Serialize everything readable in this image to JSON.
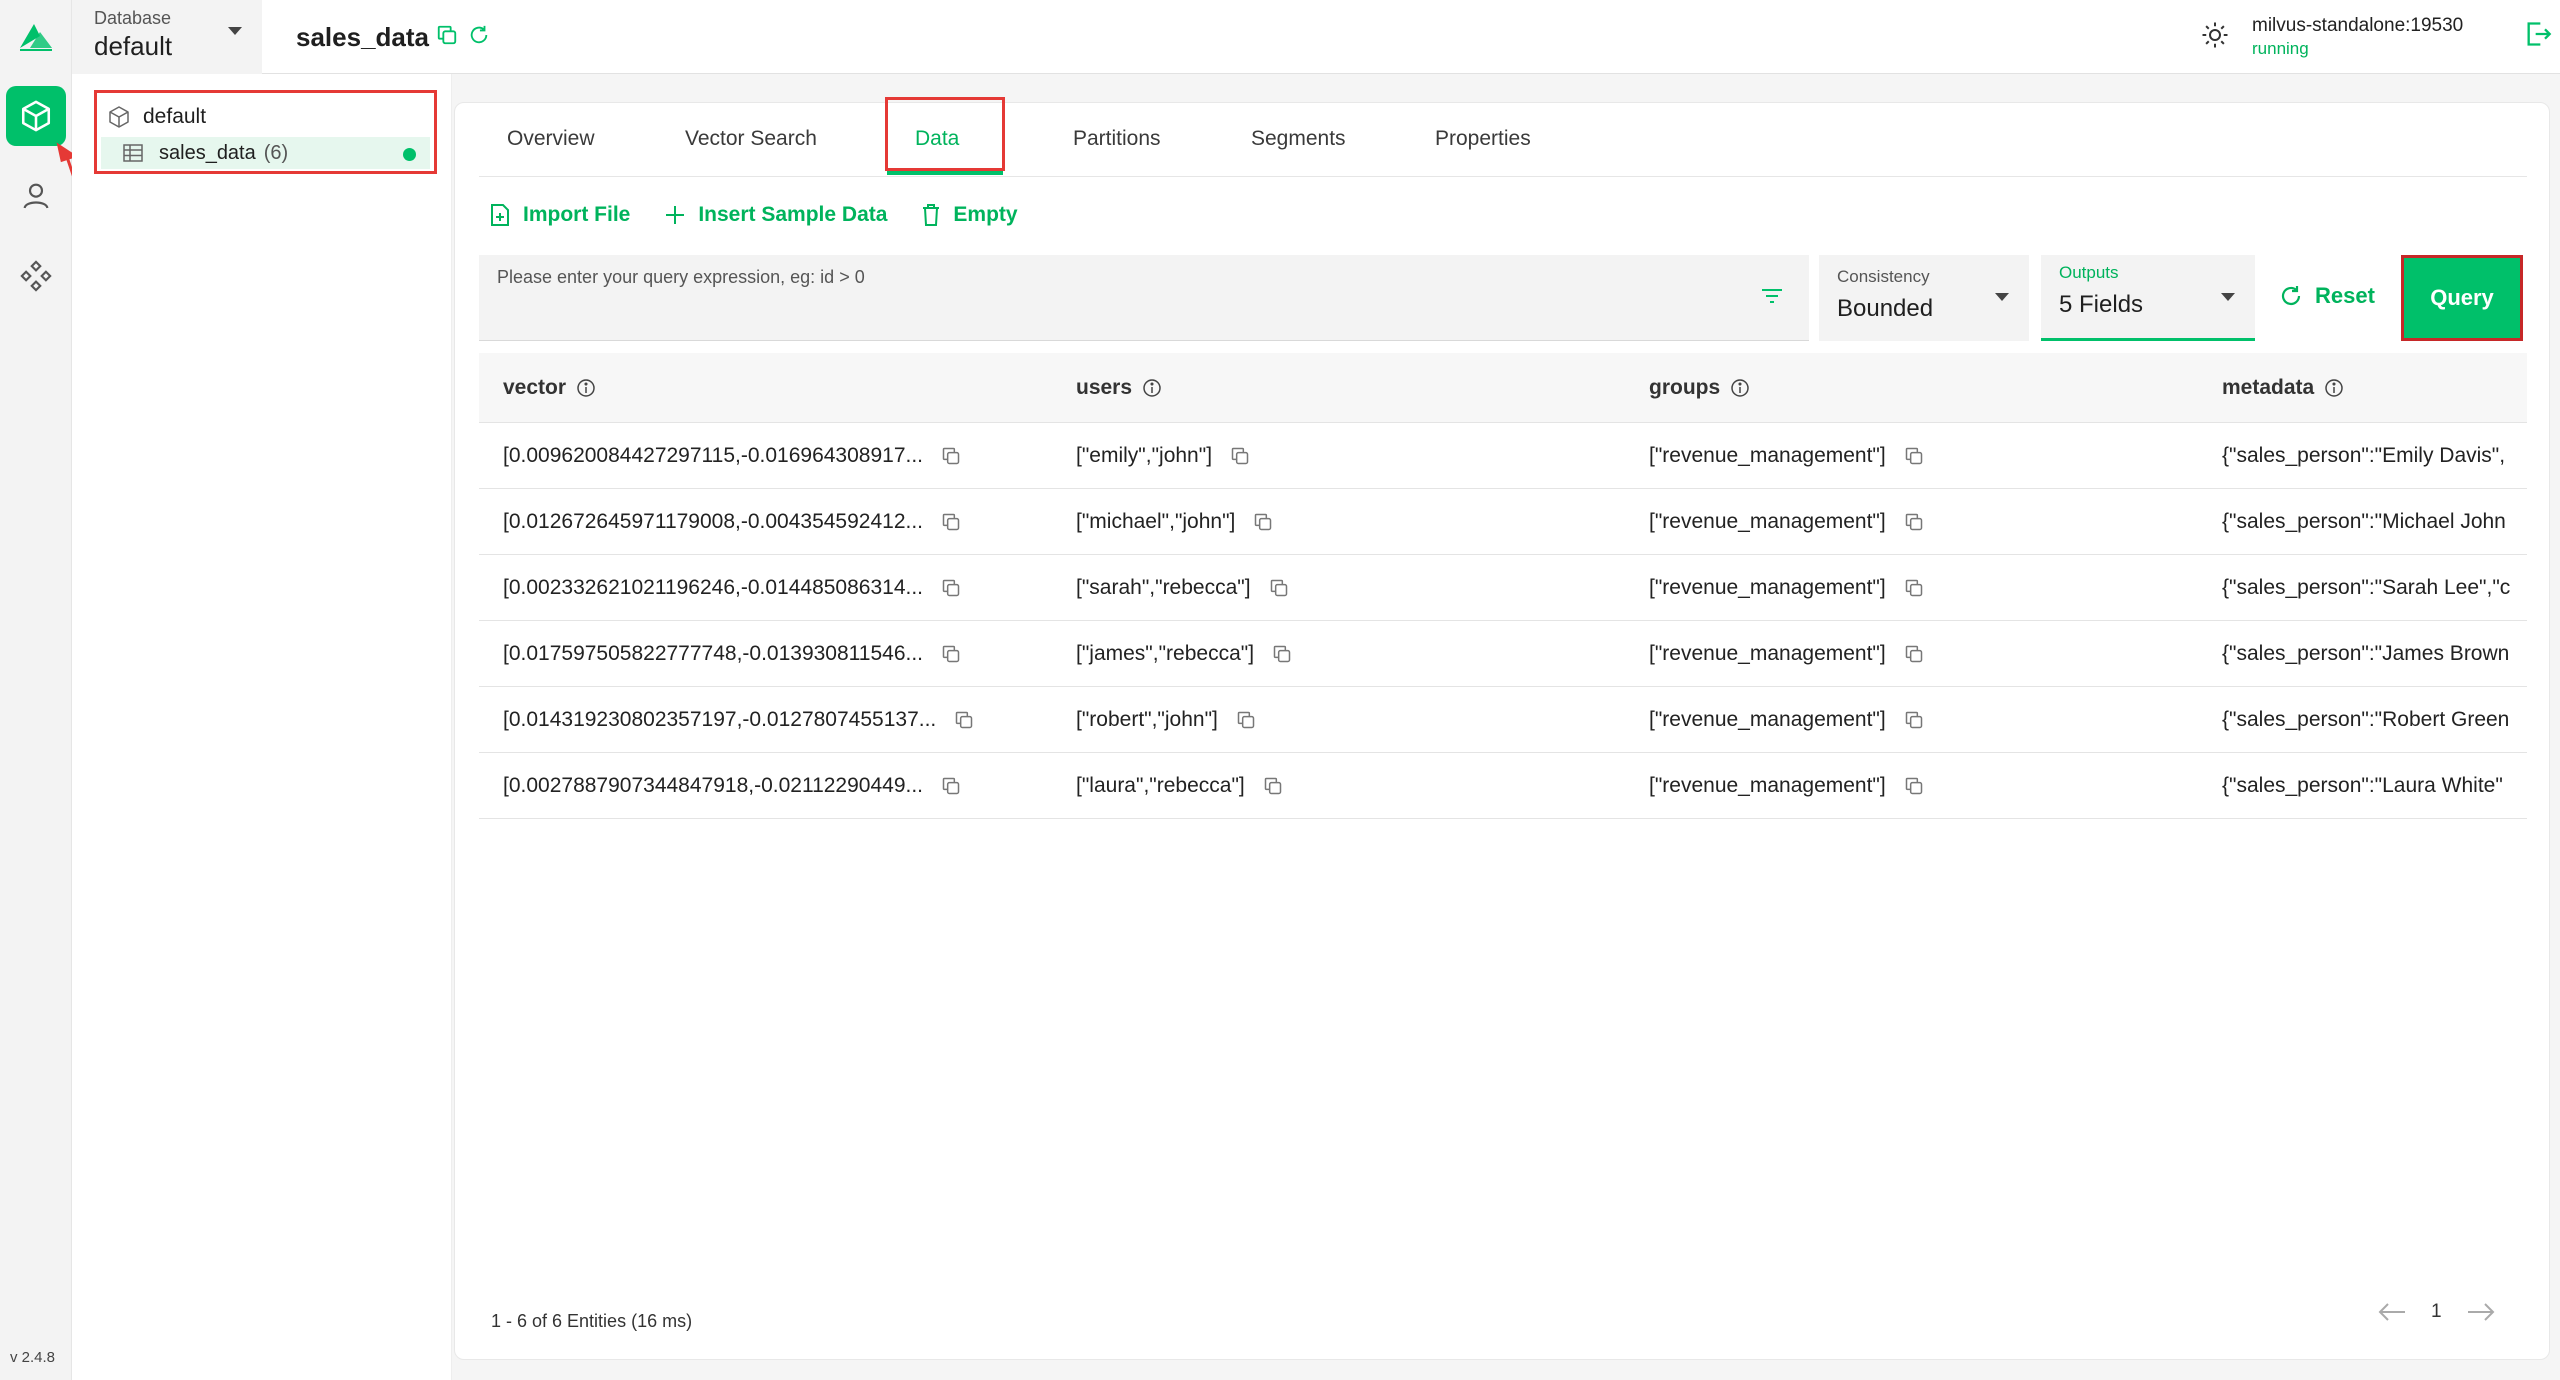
{
  "app": {
    "version": "v 2.4.8"
  },
  "header": {
    "database_label": "Database",
    "database_value": "default",
    "collection_title": "sales_data",
    "server_name": "milvus-standalone:19530",
    "server_status": "running"
  },
  "tree": {
    "database": "default",
    "collection": "sales_data",
    "collection_count": "(6)"
  },
  "tabs": [
    "Overview",
    "Vector Search",
    "Data",
    "Partitions",
    "Segments",
    "Properties"
  ],
  "actions": {
    "import": "Import File",
    "insert": "Insert Sample Data",
    "empty": "Empty"
  },
  "query": {
    "placeholder": "Please enter your query expression, eg: id > 0",
    "consistency_label": "Consistency",
    "consistency_value": "Bounded",
    "outputs_label": "Outputs",
    "outputs_value": "5 Fields",
    "reset_label": "Reset",
    "query_label": "Query"
  },
  "table": {
    "columns": [
      "vector",
      "users",
      "groups",
      "metadata"
    ],
    "rows": [
      [
        "[0.009620084427297115,-0.016964308917...",
        "[\"emily\",\"john\"]",
        "[\"revenue_management\"]",
        "{\"sales_person\":\"Emily Davis\","
      ],
      [
        "[0.012672645971179008,-0.004354592412...",
        "[\"michael\",\"john\"]",
        "[\"revenue_management\"]",
        "{\"sales_person\":\"Michael John"
      ],
      [
        "[0.0023326210211962​46,-0.014485086314...",
        "[\"sarah\",\"rebecca\"]",
        "[\"revenue_management\"]",
        "{\"sales_person\":\"Sarah Lee\",\"c"
      ],
      [
        "[0.017597505822777748,-0.013930811546...",
        "[\"james\",\"rebecca\"]",
        "[\"revenue_management\"]",
        "{\"sales_person\":\"James Brown"
      ],
      [
        "[0.014319230802357197,-0.0127807455137...",
        "[\"robert\",\"john\"]",
        "[\"revenue_management\"]",
        "{\"sales_person\":\"Robert Green"
      ],
      [
        "[0.0027887907344847918,-0.02112290449...",
        "[\"laura\",\"rebecca\"]",
        "[\"revenue_management\"]",
        "{\"sales_person\":\"Laura White\""
      ]
    ]
  },
  "footer": {
    "entities": "1 - 6  of 6 Entities (16 ms)",
    "page": "1"
  },
  "colors": {
    "accent": "#00c06a",
    "highlight": "#e53935"
  }
}
